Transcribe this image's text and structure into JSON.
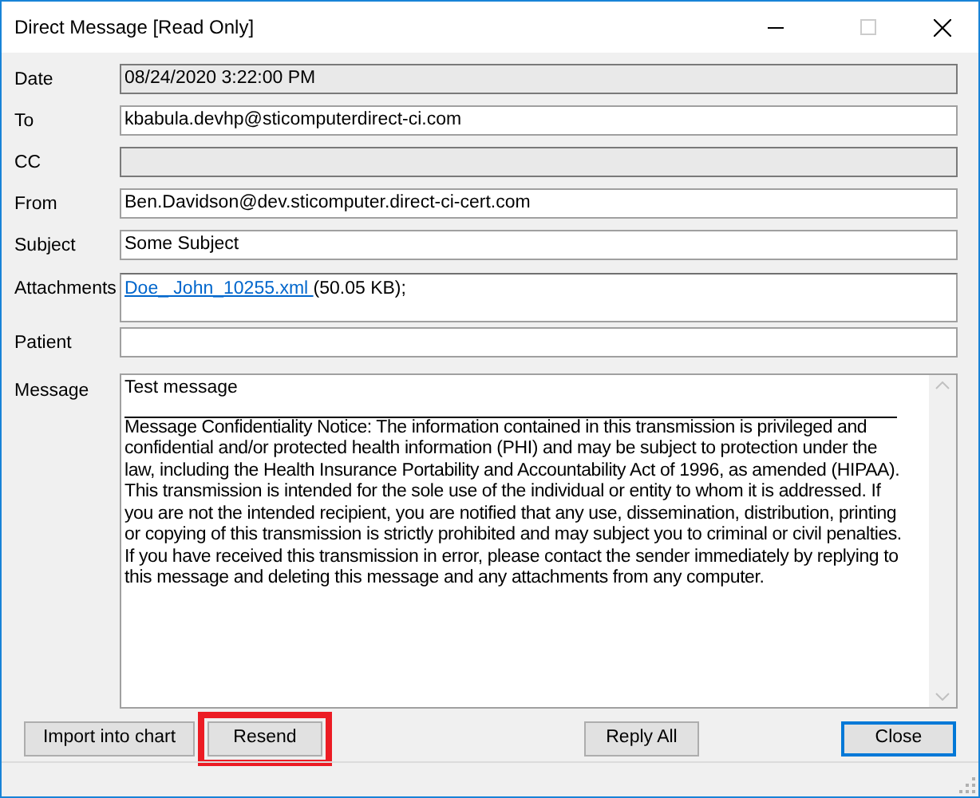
{
  "window": {
    "title": "Direct Message [Read Only]"
  },
  "fields": [
    {
      "label": "Date",
      "value": "08/24/2020 3:22:00 PM",
      "kind": "text",
      "greyed": true
    },
    {
      "label": "To",
      "value": "kbabula.devhp@sticomputerdirect-ci.com",
      "kind": "text",
      "greyed": false
    },
    {
      "label": "CC",
      "kind": "text",
      "greyed": true
    },
    {
      "label": "From",
      "value": "Ben.Davidson@dev.sticomputer.direct-ci-cert.com",
      "kind": "text",
      "greyed": false
    },
    {
      "label": "Subject",
      "value": "Some Subject",
      "kind": "text",
      "greyed": false
    },
    {
      "label": "Attachments",
      "kind": "attachments",
      "greyed": false,
      "link": "Doe_ John_10255.xml ",
      "suffix": "(50.05 KB);"
    },
    {
      "label": "Patient",
      "kind": "text",
      "greyed": false
    }
  ],
  "message": {
    "label": "Message",
    "first_line": "Test message",
    "notice": "Message Confidentiality Notice: The information contained in this transmission is privileged and confidential and/or protected health information (PHI) and may be subject to protection under the law, including the Health Insurance Portability and Accountability Act of 1996, as amended (HIPAA). This transmission is intended for the sole use of the individual or entity to whom it is addressed. If you are not the intended recipient, you are notified that any use, dissemination, distribution, printing or copying of this transmission is strictly prohibited and may subject you to criminal or civil penalties. If you have received this transmission in error, please contact the sender immediately by replying to this message and deleting this message and any attachments from any computer."
  },
  "buttons": [
    {
      "label": "Import into chart",
      "highlighted": false,
      "default": false
    },
    {
      "label": "Resend",
      "highlighted": true,
      "default": false
    },
    {
      "label": "Reply All",
      "highlighted": false,
      "default": false
    },
    {
      "label": "Close",
      "highlighted": false,
      "default": true
    }
  ]
}
